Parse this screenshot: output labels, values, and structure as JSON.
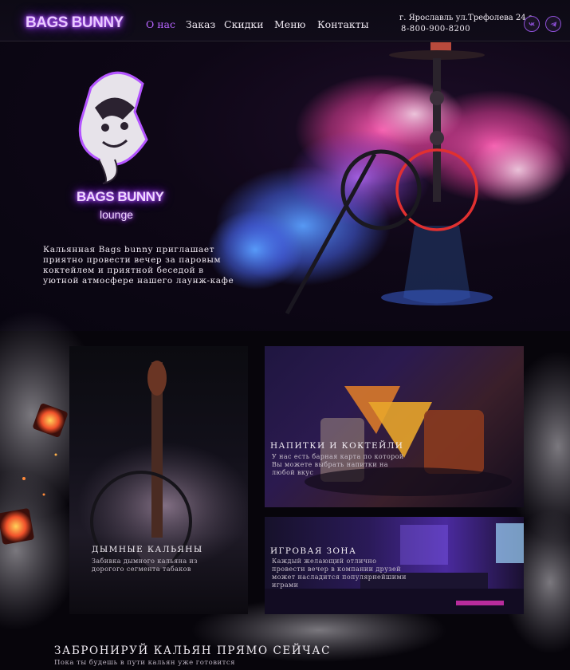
{
  "header": {
    "logo": "BAGS BUNNY",
    "nav": [
      "О нас",
      "Заказ",
      "Скидки",
      "Меню",
      "Контакты"
    ],
    "active_nav": "О нас",
    "address": "г. Ярославль ул.Трефолева 24 а",
    "phone": "8-800-900-8200",
    "social": [
      {
        "icon": "vk-icon"
      },
      {
        "icon": "telegram-icon"
      }
    ]
  },
  "hero": {
    "brand_line1": "BAGS BUNNY",
    "brand_line2": "lounge",
    "text": "Кальянная Bags bunny приглашает приятно провести вечер за паровым коктейлем и приятной беседой в уютной атмосфере нашего лаунж-кафе"
  },
  "cards": [
    {
      "title": "ДЫМНЫЕ КАЛЬЯНЫ",
      "desc": "Забивка дымного кальяна из дорогого сегмента табаков"
    },
    {
      "title": "НАПИТКИ И КОКТЕЙЛИ",
      "desc": "У нас есть барная карта по которой Вы можете выбрать напитки на любой вкус"
    },
    {
      "title": "ИГРОВАЯ ЗОНА",
      "desc": "Каждый желающий отлично провести вечер в компании друзей может насладится популярнейшими играми"
    }
  ],
  "cta": {
    "title": "ЗАБРОНИРУЙ КАЛЬЯН ПРЯМО СЕЙЧАС",
    "subtitle": "Пока ты будешь в пути кальян уже готовится"
  },
  "colors": {
    "accent": "#b765ff",
    "neon": "#9e3dff",
    "background": "#0a0710"
  }
}
